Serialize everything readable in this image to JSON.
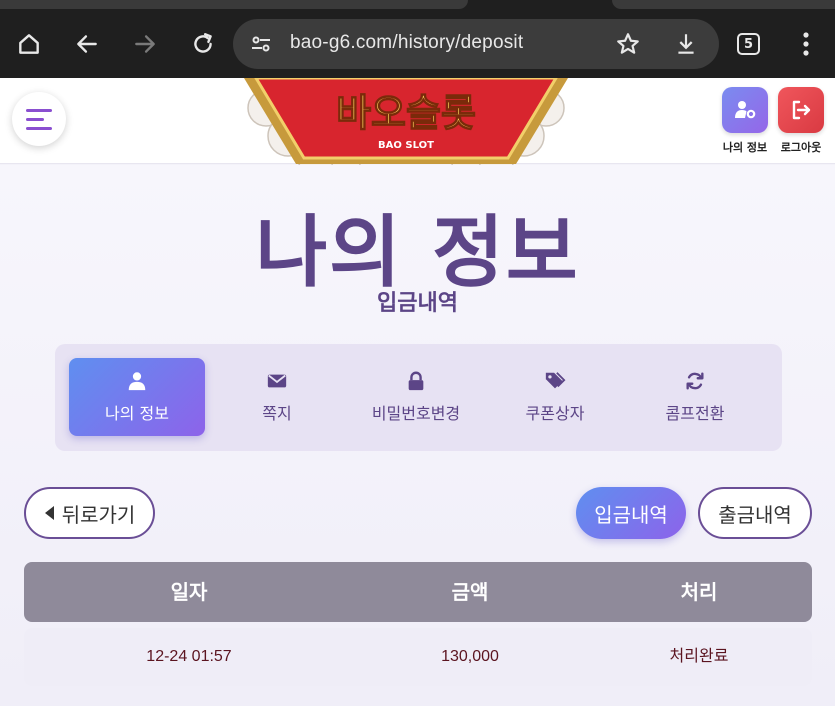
{
  "browser": {
    "url": "bao-g6.com/history/deposit",
    "tab_count": "5"
  },
  "header": {
    "logo_text": "바오슬롯",
    "logo_sub": "BAO SLOT",
    "my_info_label": "나의 정보",
    "logout_label": "로그아웃"
  },
  "page": {
    "title": "나의 정보",
    "subtitle": "입금내역"
  },
  "tabs": [
    {
      "label": "나의 정보",
      "icon": "user-icon",
      "active": true
    },
    {
      "label": "쪽지",
      "icon": "envelope-icon"
    },
    {
      "label": "비밀번호변경",
      "icon": "lock-icon"
    },
    {
      "label": "쿠폰상자",
      "icon": "tags-icon"
    },
    {
      "label": "콤프전환",
      "icon": "sync-icon"
    }
  ],
  "actions": {
    "back": "뒤로가기",
    "deposit": "입금내역",
    "withdraw": "출금내역"
  },
  "table": {
    "headers": [
      "일자",
      "금액",
      "처리"
    ],
    "rows": [
      [
        "12-24 01:57",
        "130,000",
        "처리완료"
      ]
    ]
  },
  "colors": {
    "primary": "#5c4587",
    "accent_gradient_start": "#5f8ff0",
    "accent_gradient_end": "#8d63ea",
    "logout_red": "#e8474d"
  }
}
